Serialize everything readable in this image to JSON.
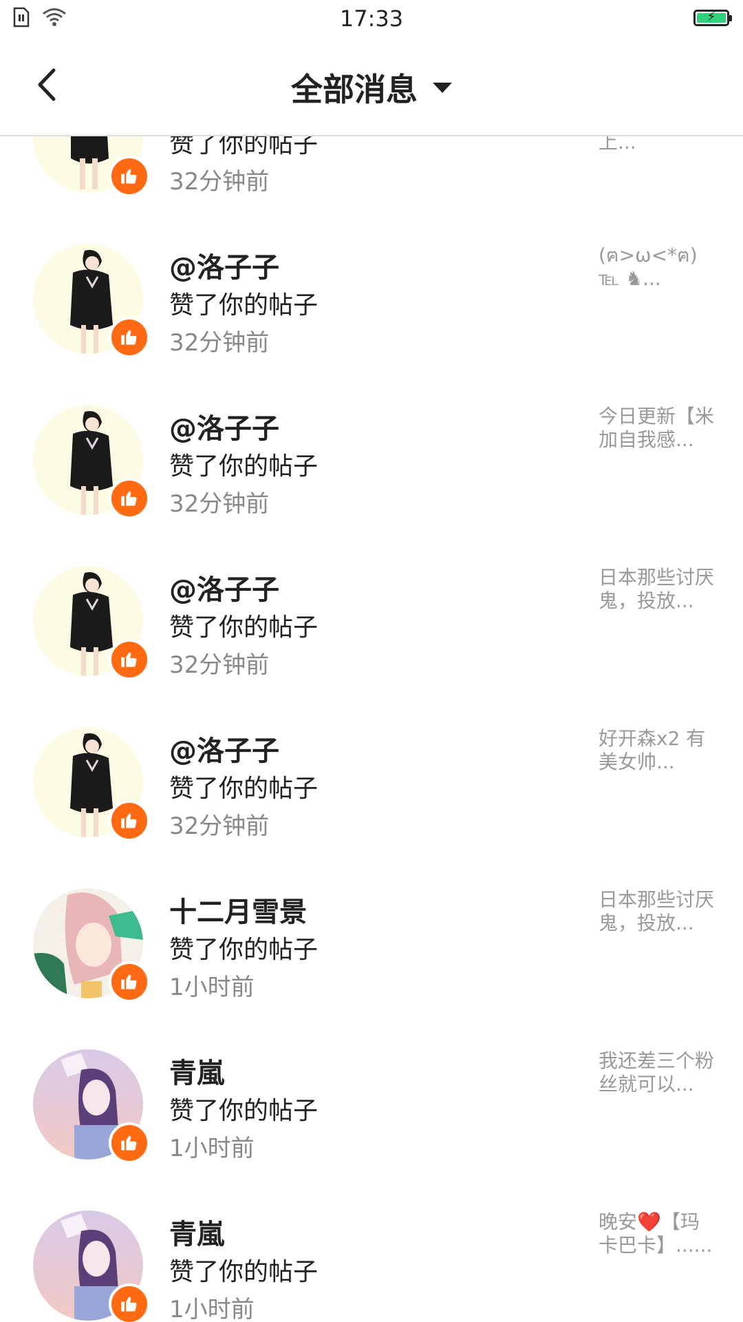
{
  "status_bar": {
    "time": "17:33",
    "icons": [
      "sim-icon",
      "wifi-icon",
      "battery-charging-icon"
    ],
    "battery_color": "#2fd17a"
  },
  "header": {
    "title": "全部消息",
    "back_icon": "chevron-left-icon",
    "dropdown_icon": "caret-down-icon"
  },
  "colors": {
    "like_badge": "#ff6a13",
    "text_primary": "#222222",
    "text_secondary": "#888888",
    "preview_text": "#999999"
  },
  "messages": [
    {
      "name": "",
      "action": "赞了你的帖子",
      "time": "32分钟前",
      "preview": "上...",
      "avatar": "anime-girl-black-dress"
    },
    {
      "name": "@洛子子",
      "action": "赞了你的帖子",
      "time": "32分钟前",
      "preview": "(ฅ>ω<*ฅ)℡ ♞...",
      "avatar": "anime-girl-black-dress"
    },
    {
      "name": "@洛子子",
      "action": "赞了你的帖子",
      "time": "32分钟前",
      "preview": "今日更新【米加自我感...",
      "avatar": "anime-girl-black-dress"
    },
    {
      "name": "@洛子子",
      "action": "赞了你的帖子",
      "time": "32分钟前",
      "preview": "日本那些讨厌鬼，投放...",
      "avatar": "anime-girl-black-dress"
    },
    {
      "name": "@洛子子",
      "action": "赞了你的帖子",
      "time": "32分钟前",
      "preview": "好开森x2 有美女帅...",
      "avatar": "anime-girl-black-dress"
    },
    {
      "name": "十二月雪景",
      "action": "赞了你的帖子",
      "time": "1小时前",
      "preview": "日本那些讨厌鬼，投放...",
      "avatar": "anime-girl-pink-hair"
    },
    {
      "name": "青嵐",
      "action": "赞了你的帖子",
      "time": "1小时前",
      "preview": "我还差三个粉丝就可以...",
      "avatar": "anime-girl-fox-mask"
    },
    {
      "name": "青嵐",
      "action": "赞了你的帖子",
      "time": "1小时前",
      "preview": "晚安❤️【玛卡巴卡】......",
      "avatar": "anime-girl-fox-mask"
    }
  ]
}
